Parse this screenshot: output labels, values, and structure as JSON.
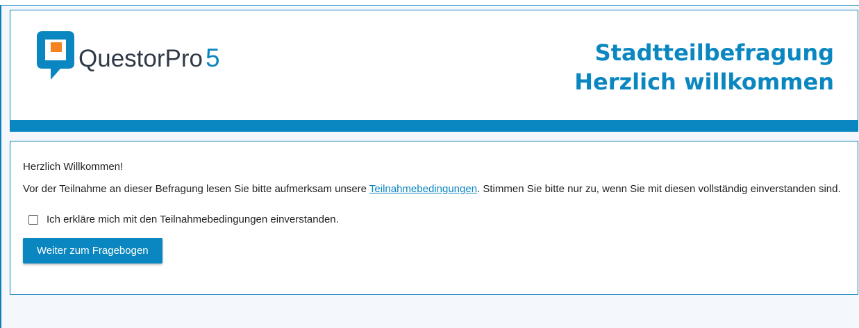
{
  "colors": {
    "brand": "#0a86c0",
    "logo_orange": "#f58220",
    "logo_text": "#2f3a46"
  },
  "header": {
    "logo_name": "QuestorPro",
    "logo_version": "5",
    "logo_icon": "questorpro-logo-icon",
    "title_line1": "Stadtteilbefragung",
    "title_line2": "Herzlich willkommen"
  },
  "intro": {
    "greeting": "Herzlich Willkommen!",
    "text_before_link": "Vor der Teilnahme an dieser Befragung lesen Sie bitte aufmerksam unsere ",
    "link_text": "Teilnahmebedingungen",
    "text_after_link": ". Stimmen Sie bitte nur zu, wenn Sie mit diesen vollständig einverstanden sind."
  },
  "consent": {
    "checked": false,
    "label": "Ich erkläre mich mit den Teilnahmebedingungen einverstanden."
  },
  "continue_button": {
    "label": "Weiter zum Fragebogen"
  }
}
